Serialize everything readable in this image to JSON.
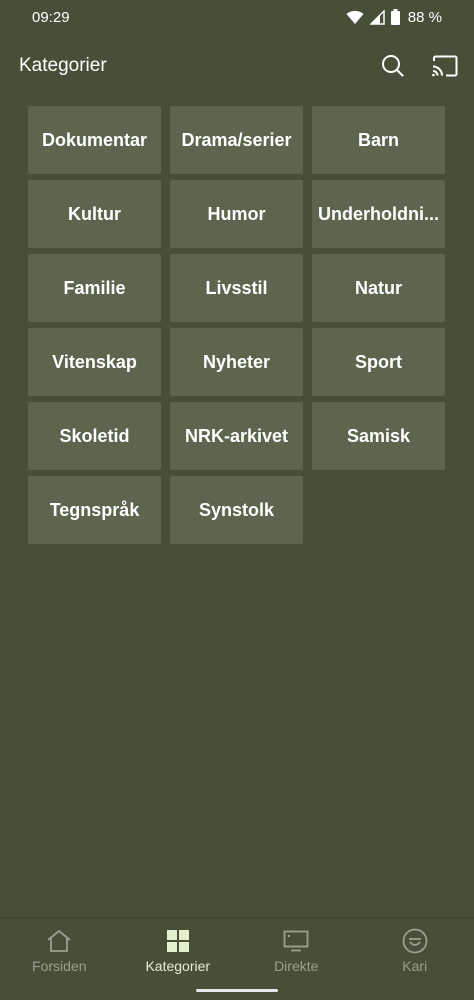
{
  "status_bar": {
    "time": "09:29",
    "battery": "88 %",
    "icons": [
      "wifi-icon",
      "signal-icon",
      "battery-icon"
    ]
  },
  "app_bar": {
    "title": "Kategorier",
    "actions": [
      "search-icon",
      "cast-icon"
    ]
  },
  "categories": [
    "Dokumentar",
    "Drama/serier",
    "Barn",
    "Kultur",
    "Humor",
    "Underholdni...",
    "Familie",
    "Livsstil",
    "Natur",
    "Vitenskap",
    "Nyheter",
    "Sport",
    "Skoletid",
    "NRK-arkivet",
    "Samisk",
    "Tegnspråk",
    "Synstolk"
  ],
  "bottom_nav": {
    "items": [
      {
        "label": "Forsiden",
        "icon": "home-icon"
      },
      {
        "label": "Kategorier",
        "icon": "grid-icon",
        "active": true
      },
      {
        "label": "Direkte",
        "icon": "tv-icon"
      },
      {
        "label": "Kari",
        "icon": "profile-icon"
      }
    ]
  },
  "colors": {
    "background": "#474f38",
    "tile": "#5d654e",
    "active_nav": "#e3f0cf",
    "inactive_nav": "#9aa08d"
  }
}
